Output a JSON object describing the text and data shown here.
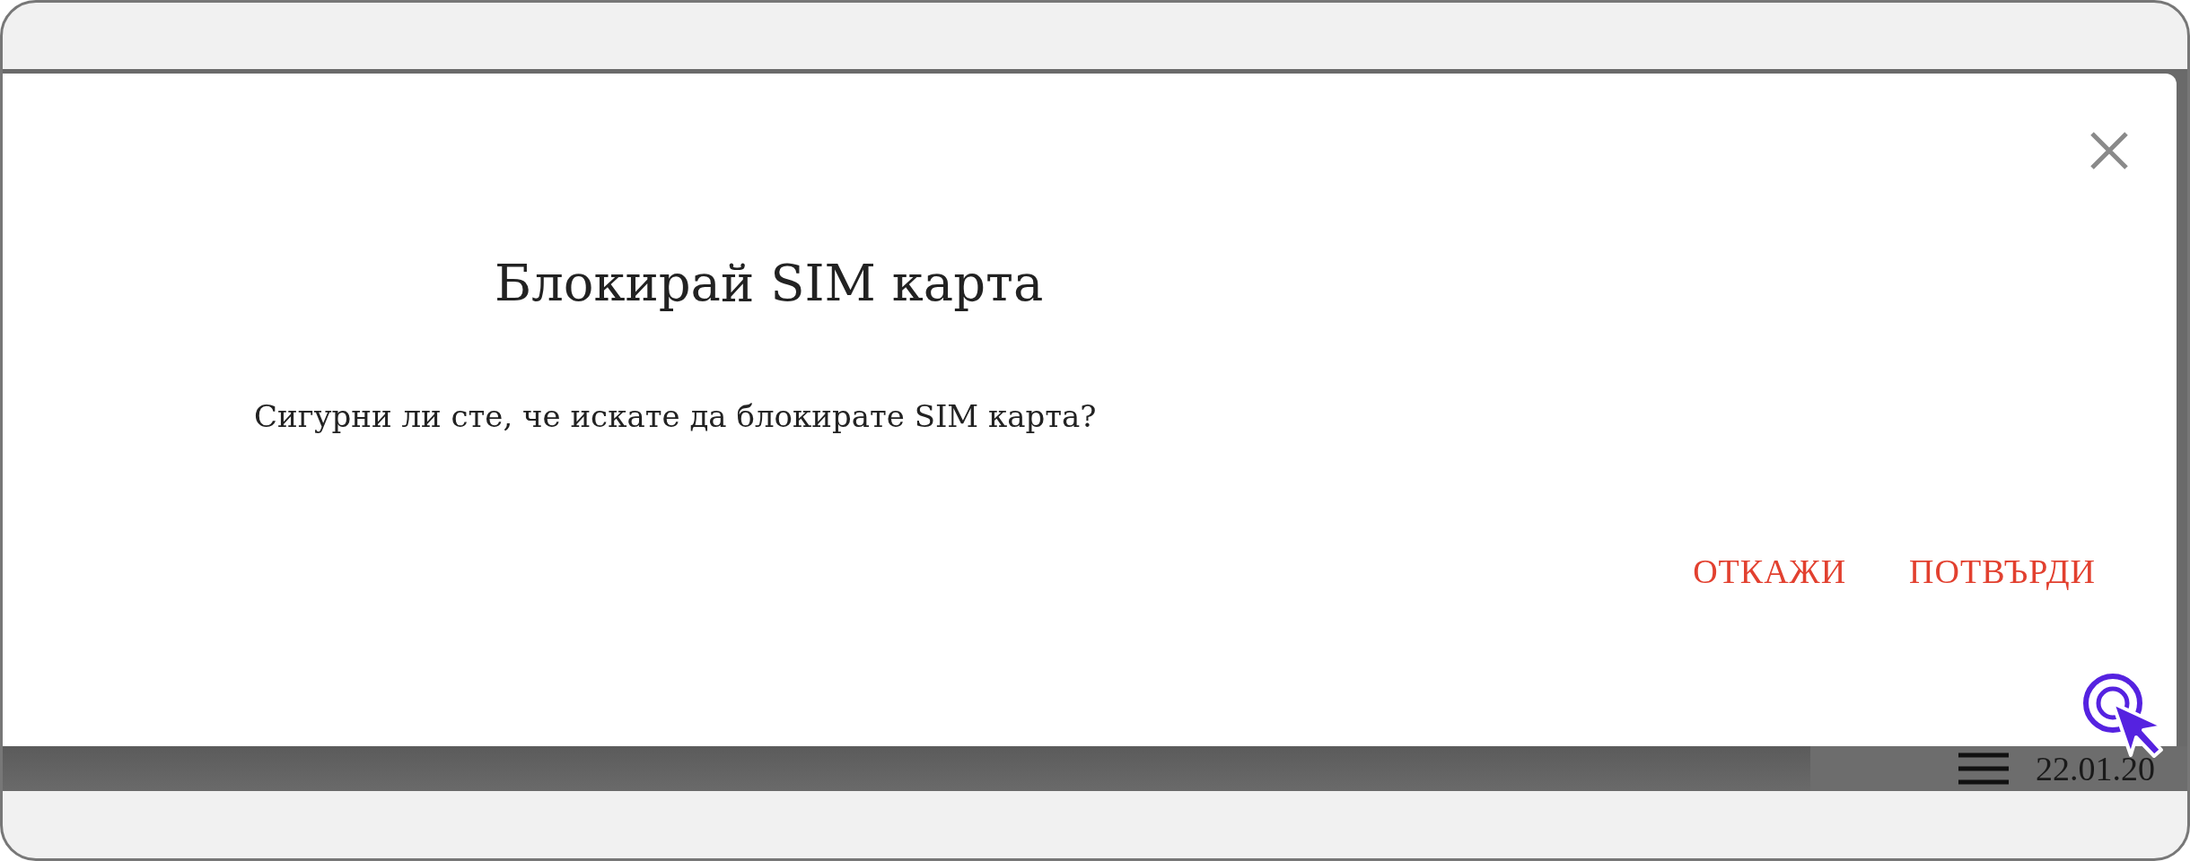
{
  "dialog": {
    "title": "Блокирай SIM карта",
    "message": "Сигурни ли сте, че искате да блокирате SIM карта?",
    "buttons": [
      {
        "label": "ОТКАЖИ"
      },
      {
        "label": "ПОТВЪРДИ"
      }
    ]
  },
  "background": {
    "date": "22.01.20"
  }
}
